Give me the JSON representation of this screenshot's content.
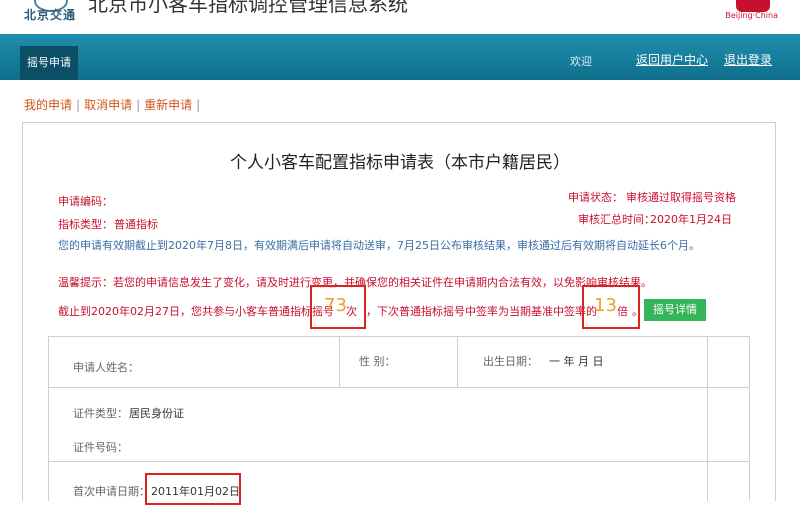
{
  "header": {
    "logo_text": "北京交通",
    "site_title": "北京市小客车指标调控管理信息系统",
    "brand_text": "Beijing·China"
  },
  "nav": {
    "active_tab": "摇号申请",
    "welcome": "欢迎",
    "return_link": "返回用户中心",
    "logout_link": "退出登录"
  },
  "sublinks": [
    "我的申请",
    "取消申请",
    "重新申请"
  ],
  "form": {
    "title": "个人小客车配置指标申请表（本市户籍居民）",
    "app_code_label": "申请编码：",
    "indicator_type_label": "指标类型：",
    "indicator_type_value": "普通指标",
    "status_label": "申请状态：",
    "status_value": "审核通过取得摇号资格",
    "summary_time_label": "审核汇总时间：",
    "summary_time_value": "2020年1月24日",
    "validity_note": "您的申请有效期截止到2020年7月8日，有效期满后申请将自动送审，7月25日公布审核结果，审核通过后有效期将自动延长6个月。",
    "warning_note": "温馨提示：若您的申请信息发生了变化，请及时进行变更，并确保您的相关证件在申请期内合法有效，以免影响审核结果。",
    "count_prefix": "截止到2020年02月27日，您共参与小客车普通指标摇号",
    "count_value": "73",
    "count_unit": "次",
    "multiple_middle": "，下次普通指标摇号中签率为当期基准中签率的",
    "multiple_value": "13",
    "multiple_unit": "倍",
    "multiple_end": "。",
    "detail_button": "摇号详情"
  },
  "table": {
    "name_label": "申请人姓名：",
    "gender_label": "性  别：",
    "birth_label": "出生日期：",
    "birth_value": "一    年    月    日",
    "id_type_label": "证件类型：",
    "id_type_value": "居民身份证",
    "id_number_label": "证件号码：",
    "first_date_label": "首次申请日期：",
    "first_date_value": "2011年01月02日"
  },
  "colors": {
    "nav_bg": "#1f8fad",
    "accent_red": "#c8102e",
    "link_orange": "#d2561b",
    "highlight_orange": "#f0a020",
    "button_green": "#35b55a"
  }
}
